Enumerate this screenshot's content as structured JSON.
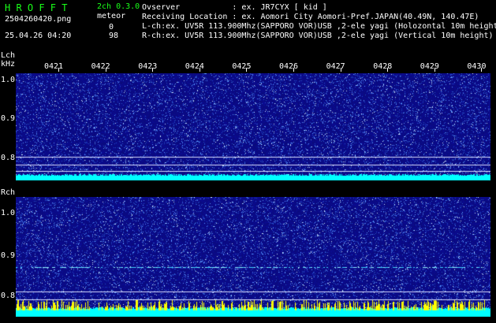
{
  "header": {
    "app_title": "H R O F F T",
    "channel_mode": "2ch 0.3.0",
    "meteor_label": "meteor",
    "filename": "2504260420.png",
    "timestamp": "25.04.26 04:20",
    "l_count": "0",
    "r_count": "98",
    "info_lines": [
      "Ovserver           : ex. JR7CYX [ kid ]",
      "Receiving Location : ex. Aomori City Aomori-Pref.JAPAN(40.49N, 140.47E)",
      "L-ch:ex. UV5R 113.900Mhz(SAPPORO VOR)USB ,2-ele yagi (Holozontal 10m height)",
      "R-ch:ex. UV5R 113.900Mhz(SAPPORO VOR)USB ,2-ele yagi (Vertical 10m height)"
    ]
  },
  "lch": {
    "label": "Lch",
    "unit": "kHz",
    "y_ticks": [
      "1.0",
      "0.9",
      "0.8"
    ],
    "time_ticks": [
      "0421",
      "0422",
      "0423",
      "0424",
      "0425",
      "0426",
      "0427",
      "0428",
      "0429",
      "0430"
    ]
  },
  "rch": {
    "label": "Rch",
    "y_ticks": [
      "1.0",
      "0.9",
      "0.8"
    ]
  },
  "colors": {
    "background": "#000000",
    "spectrogram_base": "#0a0a82",
    "noise_floor": "#00ffff",
    "meteor": "#ffff00",
    "header_green": "#19ff19"
  }
}
